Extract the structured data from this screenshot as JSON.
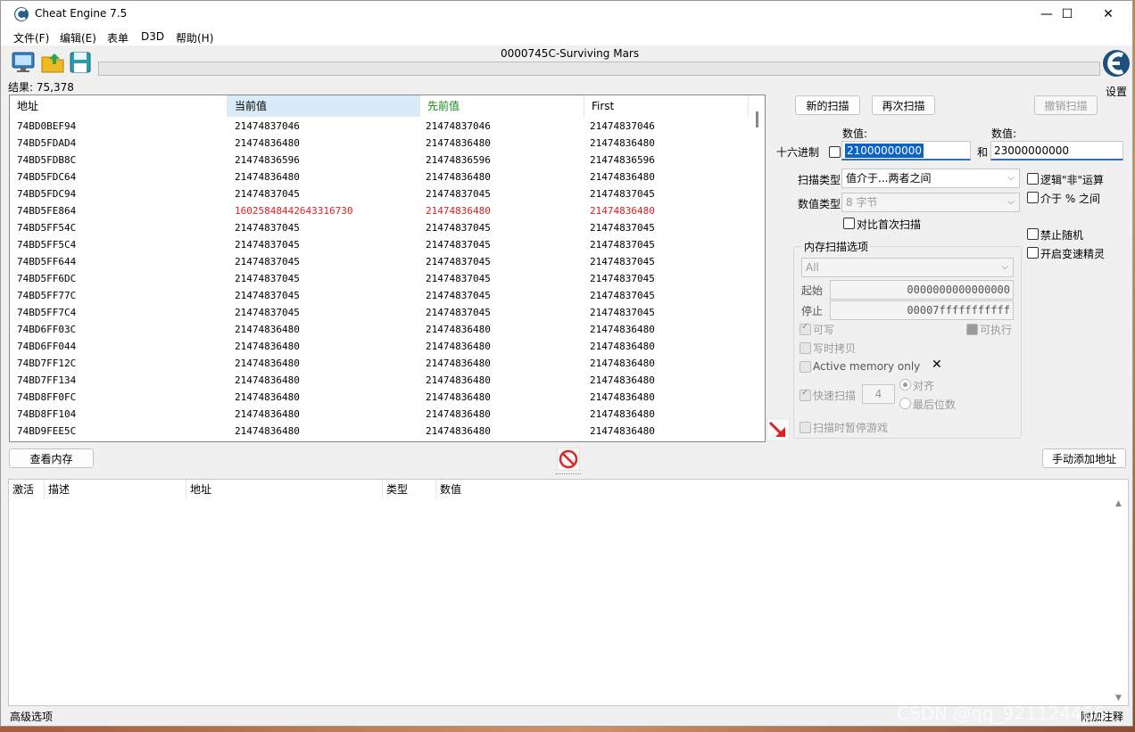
{
  "window": {
    "title": "Cheat Engine 7.5",
    "controls": [
      "—",
      "☐",
      "✕"
    ]
  },
  "menu": [
    "文件(F)",
    "编辑(E)",
    "表单",
    "D3D",
    "帮助(H)"
  ],
  "process": {
    "label": "0000745C-Surviving Mars",
    "progress": 0
  },
  "settings_label": "设置",
  "results_count": "结果: 75,378",
  "results": {
    "columns": [
      "地址",
      "当前值",
      "先前值",
      "First"
    ],
    "rows": [
      {
        "addr": "74BD0BEF94",
        "current": "21474837046",
        "previous": "21474837046",
        "first": "21474837046",
        "changed": false
      },
      {
        "addr": "74BD5FDAD4",
        "current": "21474836480",
        "previous": "21474836480",
        "first": "21474836480",
        "changed": false
      },
      {
        "addr": "74BD5FDB8C",
        "current": "21474836596",
        "previous": "21474836596",
        "first": "21474836596",
        "changed": false
      },
      {
        "addr": "74BD5FDC64",
        "current": "21474836480",
        "previous": "21474836480",
        "first": "21474836480",
        "changed": false
      },
      {
        "addr": "74BD5FDC94",
        "current": "21474837045",
        "previous": "21474837045",
        "first": "21474837045",
        "changed": false
      },
      {
        "addr": "74BD5FE864",
        "current": "16025848442643316730",
        "previous": "21474836480",
        "first": "21474836480",
        "changed": true
      },
      {
        "addr": "74BD5FF54C",
        "current": "21474837045",
        "previous": "21474837045",
        "first": "21474837045",
        "changed": false
      },
      {
        "addr": "74BD5FF5C4",
        "current": "21474837045",
        "previous": "21474837045",
        "first": "21474837045",
        "changed": false
      },
      {
        "addr": "74BD5FF644",
        "current": "21474837045",
        "previous": "21474837045",
        "first": "21474837045",
        "changed": false
      },
      {
        "addr": "74BD5FF6DC",
        "current": "21474837045",
        "previous": "21474837045",
        "first": "21474837045",
        "changed": false
      },
      {
        "addr": "74BD5FF77C",
        "current": "21474837045",
        "previous": "21474837045",
        "first": "21474837045",
        "changed": false
      },
      {
        "addr": "74BD5FF7C4",
        "current": "21474837045",
        "previous": "21474837045",
        "first": "21474837045",
        "changed": false
      },
      {
        "addr": "74BD6FF03C",
        "current": "21474836480",
        "previous": "21474836480",
        "first": "21474836480",
        "changed": false
      },
      {
        "addr": "74BD6FF044",
        "current": "21474836480",
        "previous": "21474836480",
        "first": "21474836480",
        "changed": false
      },
      {
        "addr": "74BD7FF12C",
        "current": "21474836480",
        "previous": "21474836480",
        "first": "21474836480",
        "changed": false
      },
      {
        "addr": "74BD7FF134",
        "current": "21474836480",
        "previous": "21474836480",
        "first": "21474836480",
        "changed": false
      },
      {
        "addr": "74BD8FF0FC",
        "current": "21474836480",
        "previous": "21474836480",
        "first": "21474836480",
        "changed": false
      },
      {
        "addr": "74BD8FF104",
        "current": "21474836480",
        "previous": "21474836480",
        "first": "21474836480",
        "changed": false
      },
      {
        "addr": "74BD9FEE5C",
        "current": "21474836480",
        "previous": "21474836480",
        "first": "21474836480",
        "changed": false
      }
    ]
  },
  "scan": {
    "new_scan": "新的扫描",
    "next_scan": "再次扫描",
    "undo_scan": "撤销扫描",
    "value_label": "数值:",
    "value2_label": "数值:",
    "hex_label": "十六进制",
    "value1": "21000000000",
    "and_label": "和",
    "value2": "23000000000",
    "scan_type_label": "扫描类型",
    "scan_type": "值介于...两者之间",
    "value_type_label": "数值类型",
    "value_type": "8 字节",
    "compare_first": "对比首次扫描",
    "not_op": "逻辑\"非\"运算",
    "percent_between": "介于 % 之间",
    "no_random": "禁止随机",
    "speedhack": "开启变速精灵"
  },
  "memory_options": {
    "title": "内存扫描选项",
    "region": "All",
    "start_label": "起始",
    "start_value": "0000000000000000",
    "stop_label": "停止",
    "stop_value": "00007fffffffffff",
    "writable": "可写",
    "executable": "可执行",
    "copy_on_write": "写时拷贝",
    "active_memory": "Active memory only",
    "fast_scan": "快速扫描",
    "fast_scan_value": "4",
    "align": "对齐",
    "last_digits": "最后位数",
    "pause_game": "扫描时暂停游戏"
  },
  "buttons": {
    "view_memory": "查看内存",
    "add_address": "手动添加地址"
  },
  "address_list": {
    "columns": [
      "激活",
      "描述",
      "地址",
      "类型",
      "数值"
    ]
  },
  "status": {
    "advanced": "高级选项",
    "add_comment": "附加注释"
  },
  "watermark": "CSDN @qq_921124466",
  "colors": {
    "changed": "#e02020",
    "previous_header": "#1a8a1a",
    "selected_header": "#d9eaf9"
  }
}
